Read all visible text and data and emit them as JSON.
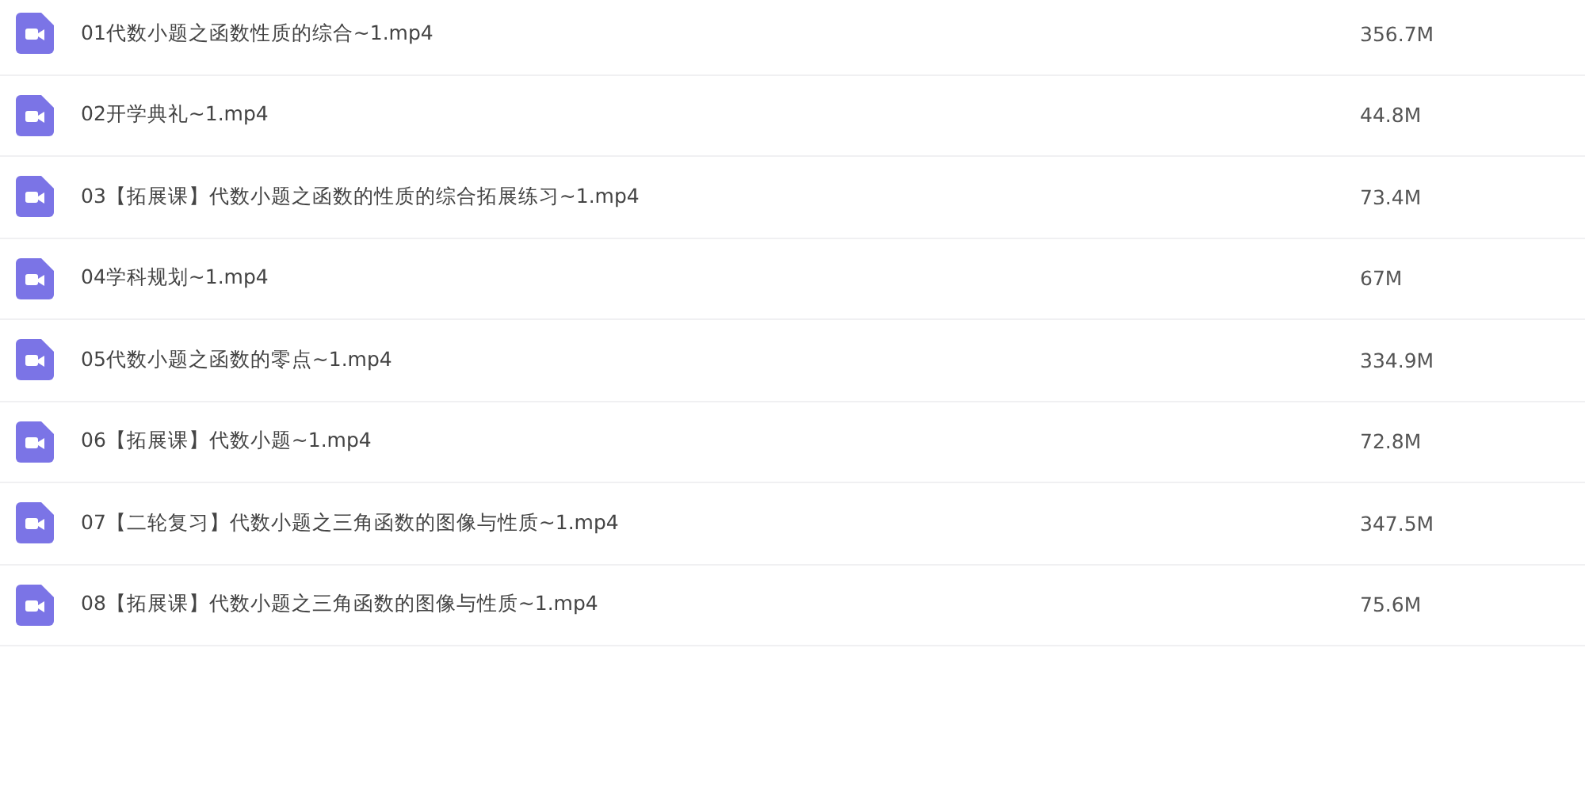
{
  "files": [
    {
      "name": "01代数小题之函数性质的综合~1.mp4",
      "size": "356.7M"
    },
    {
      "name": "02开学典礼~1.mp4",
      "size": "44.8M"
    },
    {
      "name": "03【拓展课】代数小题之函数的性质的综合拓展练习~1.mp4",
      "size": "73.4M"
    },
    {
      "name": "04学科规划~1.mp4",
      "size": "67M"
    },
    {
      "name": "05代数小题之函数的零点~1.mp4",
      "size": "334.9M"
    },
    {
      "name": "06【拓展课】代数小题~1.mp4",
      "size": "72.8M"
    },
    {
      "name": "07【二轮复习】代数小题之三角函数的图像与性质~1.mp4",
      "size": "347.5M"
    },
    {
      "name": "08【拓展课】代数小题之三角函数的图像与性质~1.mp4",
      "size": "75.6M"
    }
  ]
}
